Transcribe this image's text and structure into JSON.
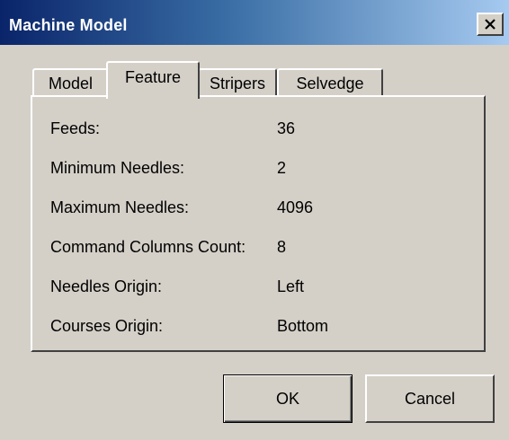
{
  "window": {
    "title": "Machine Model",
    "close_label": "Close",
    "colors": {
      "titlebar_start": "#0a246a",
      "titlebar_end": "#a6caf0",
      "face": "#d4d0c8"
    }
  },
  "tabs": [
    {
      "label": "Model",
      "active": false
    },
    {
      "label": "Feature",
      "active": true
    },
    {
      "label": "Stripers",
      "active": false
    },
    {
      "label": "Selvedge",
      "active": false
    }
  ],
  "feature": {
    "rows": [
      {
        "label": "Feeds:",
        "value": "36"
      },
      {
        "label": "Minimum Needles:",
        "value": "2"
      },
      {
        "label": "Maximum Needles:",
        "value": "4096"
      },
      {
        "label": "Command Columns Count:",
        "value": "8"
      },
      {
        "label": "Needles Origin:",
        "value": "Left"
      },
      {
        "label": "Courses Origin:",
        "value": "Bottom"
      }
    ]
  },
  "buttons": {
    "ok": "OK",
    "cancel": "Cancel"
  }
}
